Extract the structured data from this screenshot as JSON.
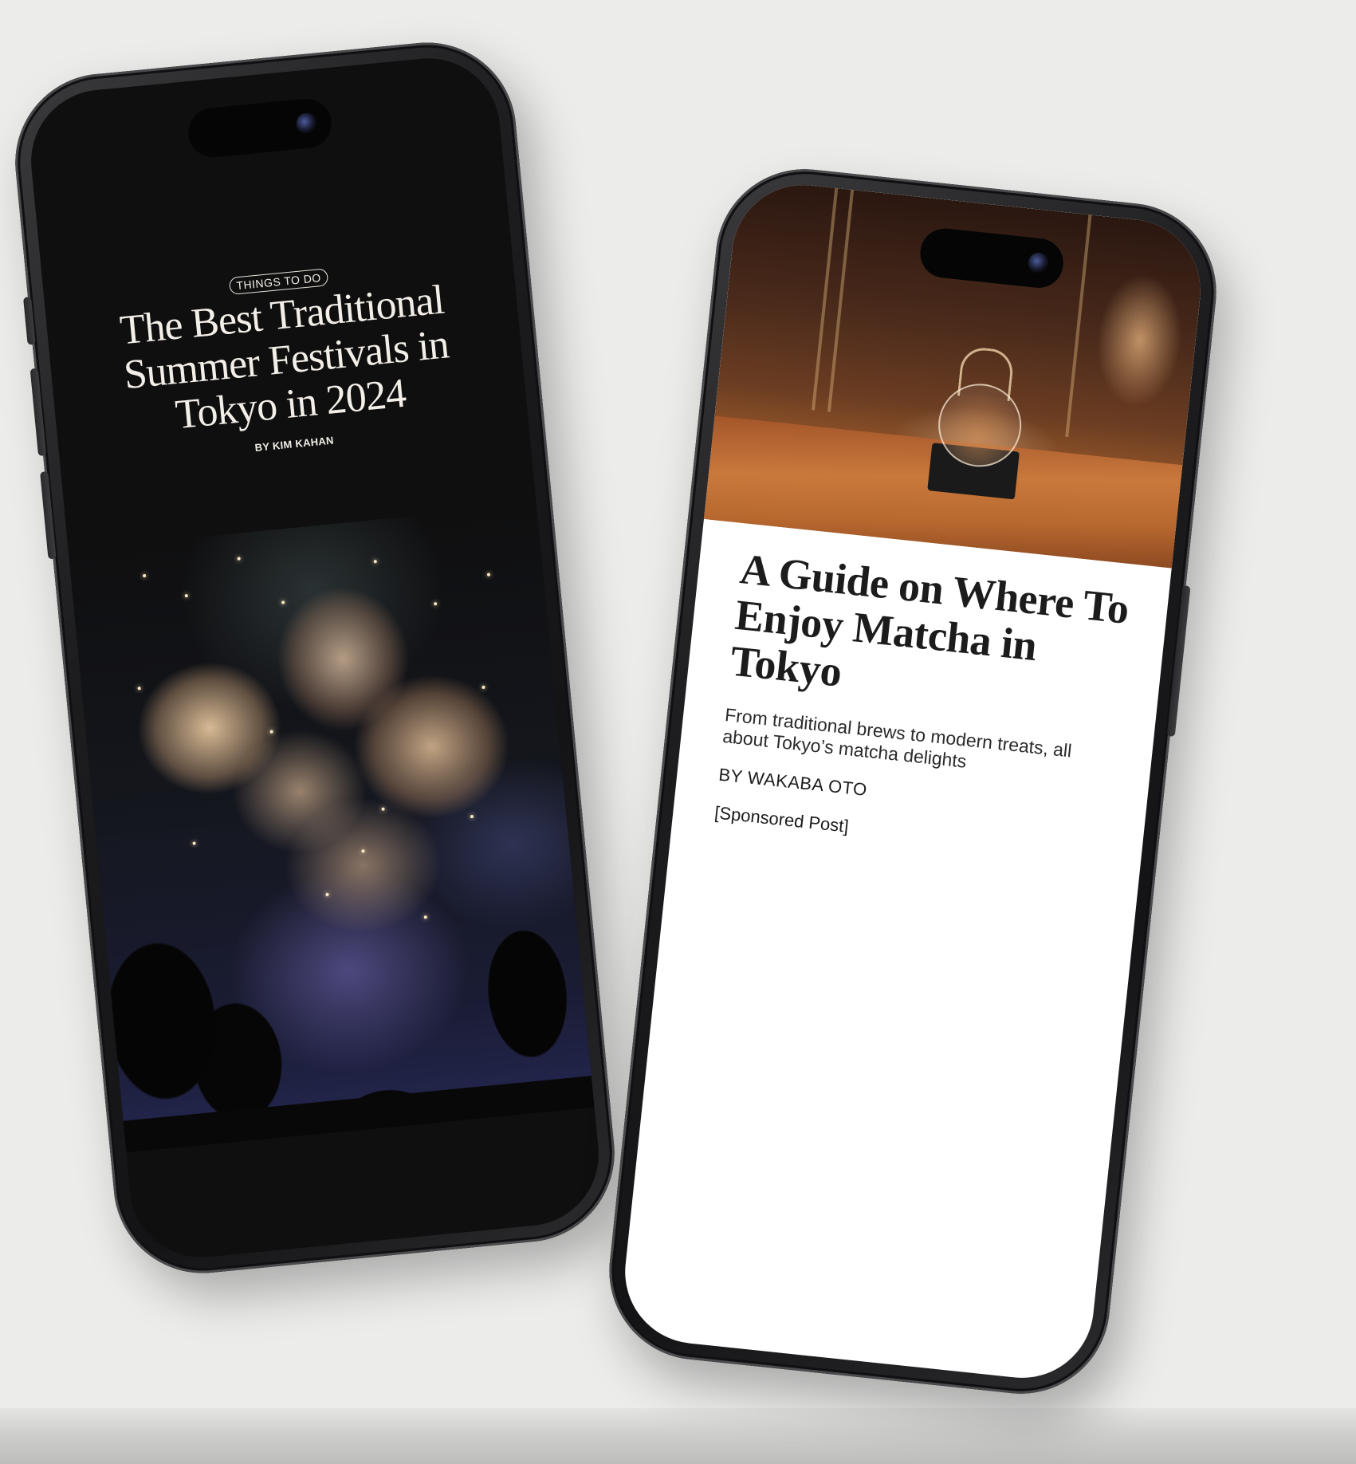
{
  "left_phone": {
    "category_tag": "THINGS TO DO",
    "title": "The Best Traditional Summer Festivals in Tokyo in 2024",
    "byline": "BY KIM KAHAN",
    "image_icon": "fireworks-photo"
  },
  "right_phone": {
    "title": "A Guide on Where To Enjoy Matcha in Tokyo",
    "subtitle": "From traditional brews to modern treats, all about Tokyo’s matcha delights",
    "byline": "BY WAKABA OTO",
    "sponsored": "[Sponsored Post]",
    "image_icon": "teapot-photo"
  },
  "colors": {
    "background": "#ececeb",
    "phone_frame": "#1d1d1f",
    "left_screen": "#0f0f10",
    "right_screen": "#ffffff"
  }
}
